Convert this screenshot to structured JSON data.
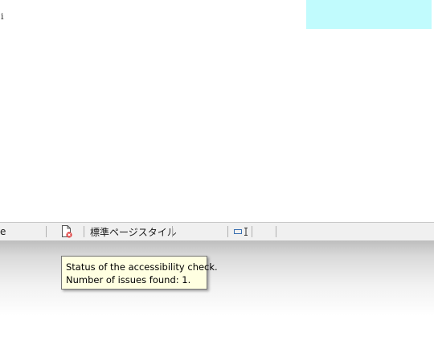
{
  "document": {
    "glyph": "i"
  },
  "statusbar": {
    "left_text": "e",
    "accessibility_icon": "document-error-icon",
    "page_style": "標準ページスタイル",
    "insert_mode_icon": "selection-mode-icon",
    "accent_error": "#e03c3c"
  },
  "tooltip": {
    "line1": "Status of the accessibility check.",
    "line2": "Number of issues found: 1."
  }
}
